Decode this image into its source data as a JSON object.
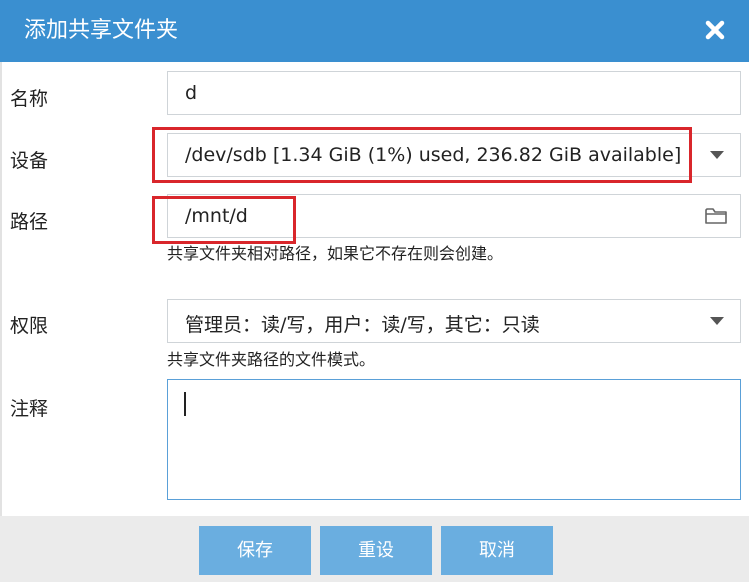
{
  "dialog": {
    "title": "添加共享文件夹",
    "close_icon": "close-icon"
  },
  "form": {
    "name": {
      "label": "名称",
      "value": "d"
    },
    "device": {
      "label": "设备",
      "value": "/dev/sdb [1.34 GiB (1%) used, 236.82 GiB available]"
    },
    "path": {
      "label": "路径",
      "value": "/mnt/d",
      "hint": "共享文件夹相对路径，如果它不存在则会创建。"
    },
    "permissions": {
      "label": "权限",
      "value": "管理员：读/写，用户：读/写，其它：只读",
      "hint": "共享文件夹路径的文件模式。"
    },
    "comment": {
      "label": "注释",
      "value": ""
    }
  },
  "buttons": {
    "save": "保存",
    "reset": "重设",
    "cancel": "取消"
  },
  "colors": {
    "title_bar": "#3a8fd0",
    "button": "#6aaee0",
    "highlight": "#d9262b"
  }
}
